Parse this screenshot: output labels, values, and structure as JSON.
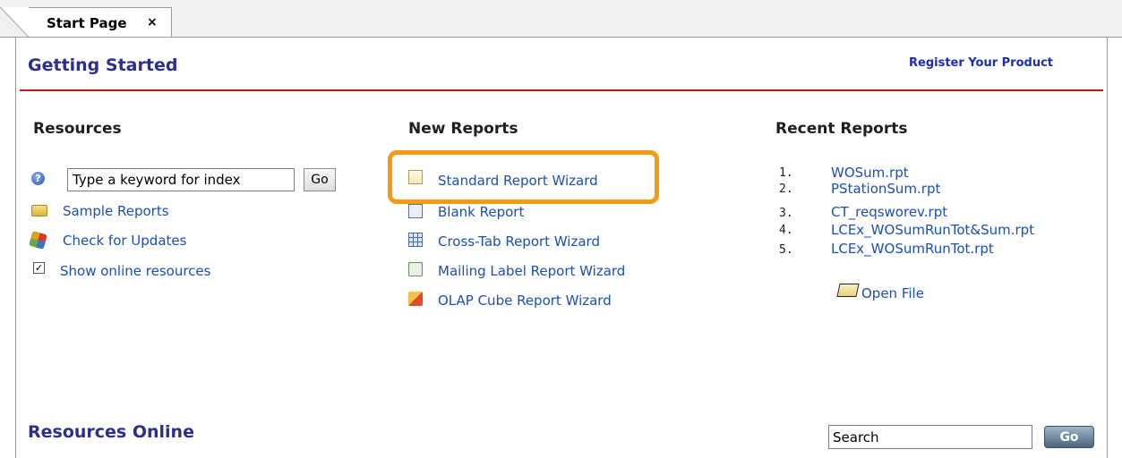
{
  "tab": {
    "label": "Start Page",
    "close": "×"
  },
  "header": {
    "title": "Getting Started",
    "register_link": "Register Your Product"
  },
  "resources": {
    "heading": "Resources",
    "index_input_value": "Type a keyword for index",
    "go_label": "Go",
    "items": [
      {
        "label": "Sample Reports",
        "icon": "folder-icon"
      },
      {
        "label": "Check for Updates",
        "icon": "update-icon"
      }
    ],
    "show_online": {
      "label": "Show online resources",
      "checked": true,
      "mark": "✓"
    }
  },
  "new_reports": {
    "heading": "New Reports",
    "items": [
      {
        "label": "Standard Report Wizard",
        "icon": "standard-report-icon"
      },
      {
        "label": "Blank Report",
        "icon": "blank-report-icon"
      },
      {
        "label": "Cross-Tab Report Wizard",
        "icon": "crosstab-report-icon"
      },
      {
        "label": "Mailing Label Report Wizard",
        "icon": "mailing-label-icon"
      },
      {
        "label": "OLAP Cube Report Wizard",
        "icon": "olap-cube-icon"
      }
    ],
    "highlight_color": "#f59a12"
  },
  "recent_reports": {
    "heading": "Recent Reports",
    "items": [
      {
        "num": "1.",
        "label": "WOSum.rpt"
      },
      {
        "num": "2.",
        "label": "PStationSum.rpt"
      },
      {
        "num": "3.",
        "label": "CT_reqsworev.rpt"
      },
      {
        "num": "4.",
        "label": "LCEx_WOSumRunTot&Sum.rpt"
      },
      {
        "num": "5.",
        "label": "LCEx_WOSumRunTot.rpt"
      }
    ],
    "open_file": "Open File"
  },
  "footer": {
    "title": "Resources Online",
    "search_value": "Search",
    "go_label": "Go"
  },
  "colors": {
    "accent": "#2a2f8f",
    "link": "#1a4fb5",
    "rule": "#c01a1a"
  }
}
